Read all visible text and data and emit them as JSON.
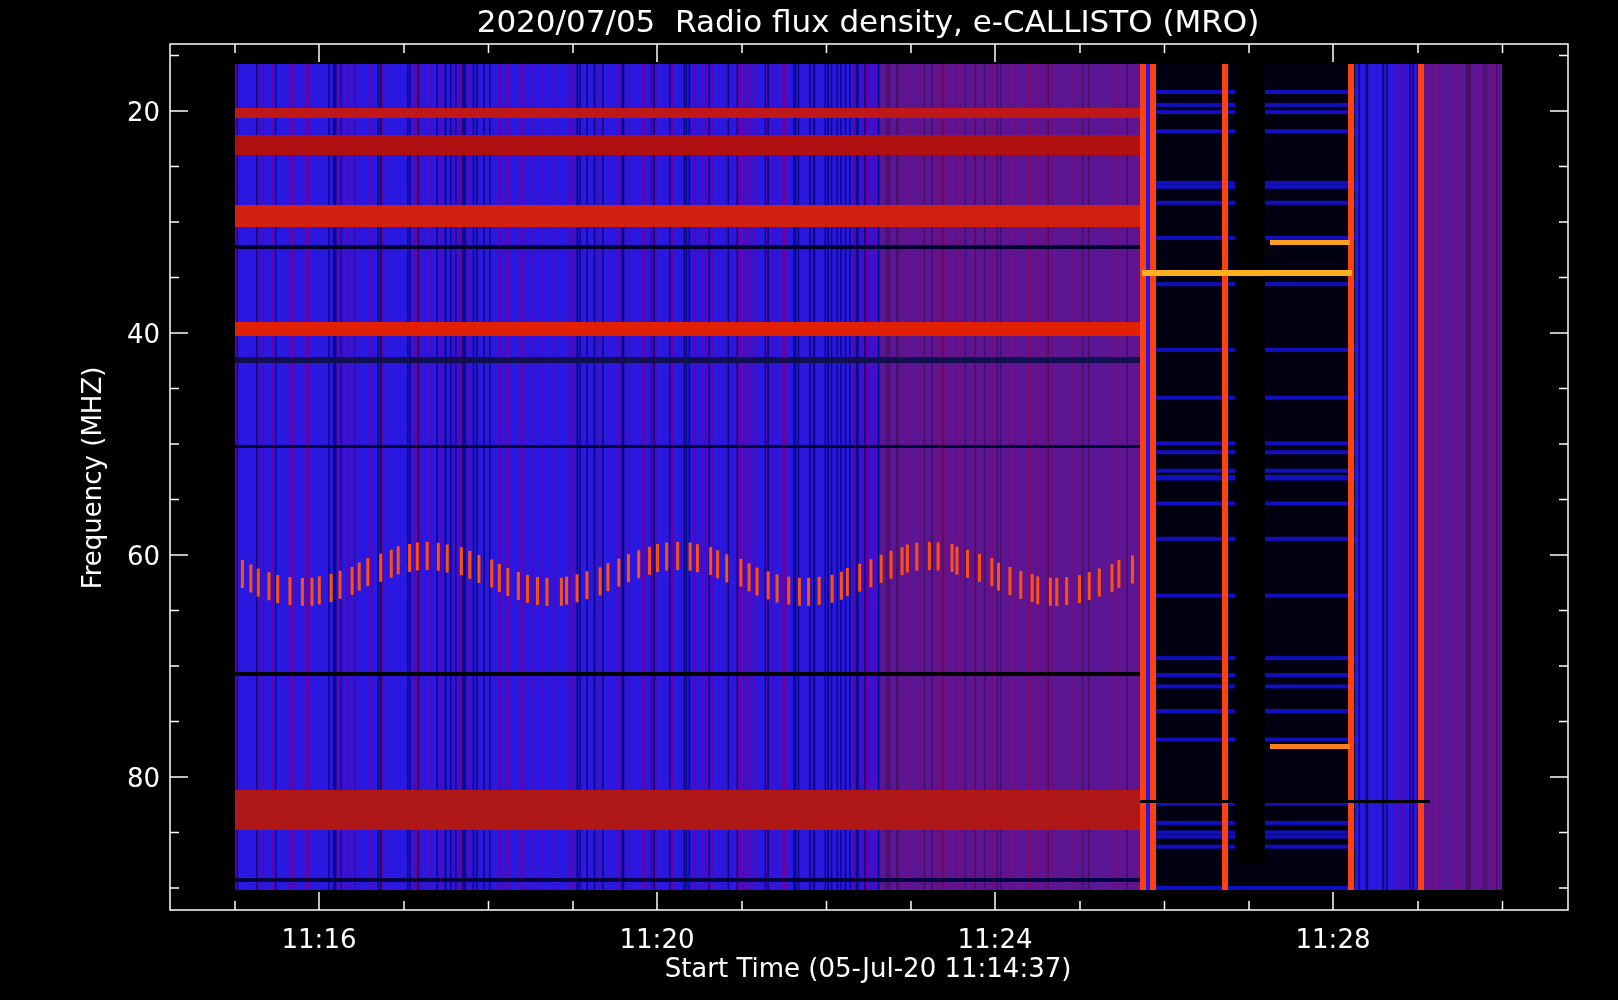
{
  "title": "2020/07/05  Radio flux density, e-CALLISTO (MRO)",
  "y_axis": {
    "label": "Frequency (MHZ)",
    "ticks": [
      "20",
      "40",
      "60",
      "80"
    ]
  },
  "x_axis": {
    "label": "Start Time (05-Jul-20 11:14:37)",
    "ticks": [
      "11:16",
      "11:20",
      "11:24",
      "11:28"
    ]
  }
}
